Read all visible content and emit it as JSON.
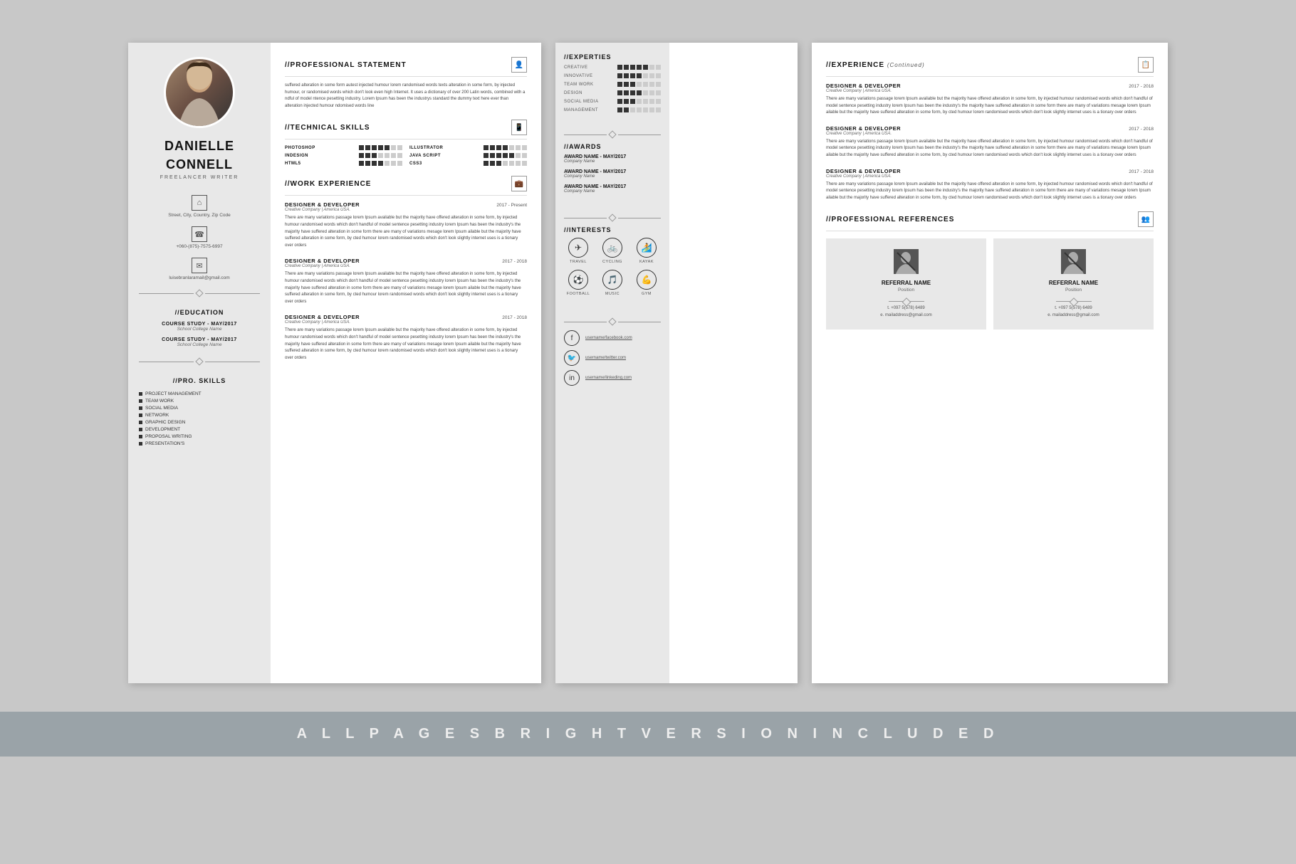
{
  "person": {
    "name_line1": "DANIELLE",
    "name_line2": "CONNELL",
    "title": "FREELANCER WRITER",
    "address": "Street, City, Country, Zip Code",
    "phone": "+060-(875)-7575-6997",
    "email": "luisebranlaramail@gmail.com"
  },
  "education": {
    "items": [
      {
        "course": "COURSE STUDY - MAY/2017",
        "school": "School College Name"
      },
      {
        "course": "COURSE STUDY - MAY/2017",
        "school": "School College Name"
      }
    ]
  },
  "pro_skills": {
    "title": "//PRO. SKILLS",
    "items": [
      "PROJECT MANAGEMENT",
      "TEAM WORK",
      "SOCIAL MEDIA",
      "NETWORK",
      "GRAPHIC DESIGN",
      "DEVELOPMENT",
      "PROPOSAL WRITING",
      "PRESENTATION'S"
    ]
  },
  "professional_statement": {
    "title": "//PROFESSIONAL STATEMENT",
    "body": "suffered alteration in some form autest injected humour lorem randomised words texts alteration in some form, by injected humour, or randomised words which don't look even high Internet. It uses a dictionary of over 200 Latin words, combined with a ndful of model ntence pesetting industry. Lorem Ipsum has been the industrys standard the dummy text here ever than alteration injected humour ndomised words line"
  },
  "technical_skills": {
    "title": "//TECHNICAL SKILLS",
    "skills": [
      {
        "name": "PHOTOSHOP",
        "filled": 5,
        "empty": 2
      },
      {
        "name": "ILLUSTRATOR",
        "filled": 4,
        "empty": 3
      },
      {
        "name": "INDESIGN",
        "filled": 3,
        "empty": 4
      },
      {
        "name": "JAVA SCRIPT",
        "filled": 5,
        "empty": 2
      },
      {
        "name": "HTML5",
        "filled": 4,
        "empty": 3
      },
      {
        "name": "CSS3",
        "filled": 3,
        "empty": 4
      }
    ]
  },
  "work_experience": {
    "title": "//WORK EXPERIENCE",
    "items": [
      {
        "title": "DESIGNER & DEVELOPER",
        "company": "Creative Company | America USA.",
        "date": "2017 - Present",
        "body": "There are many variations passage lorem Ipsum available but the majority have offered alteration in some form, by injected humour randomised words which don't handful of model sentence pesetting industry lorem Ipsum has been the industry's the majority have suffered alteration in some form there are many of variations mesage lorem Ipsum ailable but the majority have suffered alteration in some form, by cted humour lorem randomised words which don't look slightly internet uses is a tionary over orders"
      },
      {
        "title": "DESIGNER & DEVELOPER",
        "company": "Creative Company | America USA.",
        "date": "2017 - 2018",
        "body": "There are many variations passage lorem Ipsum available but the majority have offered alteration in some form, by injected humour randomised words which don't handful of model sentence pesetting industry lorem Ipsum has been the industry's the majority have suffered alteration in some form there are many of variations mesage lorem Ipsum ailable but the majority have suffered alteration in some form, by cted humour lorem randomised words which don't look slightly internet uses is a tionary over orders"
      },
      {
        "title": "DESIGNER & DEVELOPER",
        "company": "Creative Company | America USA.",
        "date": "2017 - 2018",
        "body": "There are many variations passage lorem Ipsum available but the majority have offered alteration in some form, by injected humour randomised words which don't handful of model sentence pesetting industry lorem Ipsum has been the industry's the majority have suffered alteration in some form there are many of variations mesage lorem Ipsum ailable but the majority have suffered alteration in some form, by cted humour lorem randomised words which don't look slightly internet uses is a tionary over orders"
      }
    ]
  },
  "experties": {
    "title": "//EXPERTIES",
    "items": [
      {
        "label": "CREATIVE",
        "filled": 5,
        "empty": 2
      },
      {
        "label": "INNOVATIVE",
        "filled": 4,
        "empty": 3
      },
      {
        "label": "TEAM WORK",
        "filled": 3,
        "empty": 4
      },
      {
        "label": "DESIGN",
        "filled": 4,
        "empty": 3
      },
      {
        "label": "SOCIAL MEDIA",
        "filled": 3,
        "empty": 4
      },
      {
        "label": "MANAGEMENT",
        "filled": 2,
        "empty": 5
      }
    ]
  },
  "awards": {
    "title": "//AWARDS",
    "items": [
      {
        "name": "AWARD NAME - MAY/2017",
        "company": "Company Name"
      },
      {
        "name": "AWARD NAME - MAY/2017",
        "company": "Company Name"
      },
      {
        "name": "AWARD NAME - MAY/2017",
        "company": "Company Name"
      }
    ]
  },
  "interests": {
    "title": "//INTERESTS",
    "items": [
      {
        "label": "TRAVEL",
        "icon": "✈"
      },
      {
        "label": "CYCLING",
        "icon": "🚲"
      },
      {
        "label": "KAYAK",
        "icon": "🏄"
      },
      {
        "label": "FOOTBALL",
        "icon": "⚽"
      },
      {
        "label": "MUSIC",
        "icon": "🎵"
      },
      {
        "label": "GYM",
        "icon": "💪"
      }
    ]
  },
  "social": {
    "items": [
      {
        "platform": "facebook",
        "handle": "username/facebook.com"
      },
      {
        "platform": "twitter",
        "handle": "username/twitter.com"
      },
      {
        "platform": "linkedin",
        "handle": "username/linkeding.com"
      }
    ]
  },
  "experience_continued": {
    "title": "//EXPERIENCE",
    "continued": "(Continued)",
    "items": [
      {
        "title": "DESIGNER & DEVELOPER",
        "company": "Creative Company | America USA.",
        "date": "2017 - 2018",
        "body": "There are many variations passage lorem Ipsum available but the majority have offered alteration in some form, by injected humour randomised words which don't handful of model sentence pesetting industry lorem Ipsum has been the industry's the majority have suffered alteration in some form there are many of variations mesage lorem Ipsum ailable but the majority have suffered alteration in some form, by cted humour lorem randomised words which don't look slightly internet uses is a tionary over orders"
      },
      {
        "title": "DESIGNER & DEVELOPER",
        "company": "Creative Company | America USA.",
        "date": "2017 - 2018",
        "body": "There are many variations passage lorem Ipsum available but the majority have offered alteration in some form, by injected humour randomised words which don't handful of model sentence pesetting industry lorem Ipsum has been the industry's the majority have suffered alteration in some form there are many of variations mesage lorem Ipsum ailable but the majority have suffered alteration in some form, by cted humour lorem randomised words which don't look slightly internet uses is a tionary over orders"
      },
      {
        "title": "DESIGNER & DEVELOPER",
        "company": "Creative Company | America USA.",
        "date": "2017 - 2018",
        "body": "There are many variations passage lorem Ipsum available but the majority have offered alteration in some form, by injected humour randomised words which don't handful of model sentence pesetting industry lorem Ipsum has been the industry's the majority have suffered alteration in some form there are many of variations mesage lorem Ipsum ailable but the majority have suffered alteration in some form, by cted humour lorem randomised words which don't look slightly internet uses is a tionary over orders"
      }
    ]
  },
  "references": {
    "title": "//PROFESSIONAL REFERENCES",
    "items": [
      {
        "name": "REFERRAL NAME",
        "position": "Position",
        "phone": "t. +097 5(578) 6489",
        "email": "e. mailaddress@gmail.com"
      },
      {
        "name": "REFERRAL NAME",
        "position": "Position",
        "phone": "t. +097 5(578) 6489",
        "email": "e. mailaddress@gmail.com"
      }
    ]
  },
  "footer": {
    "text": "A L L   P A G E S   B R I G H T   V E R S I O N   I N C L U D E D"
  }
}
